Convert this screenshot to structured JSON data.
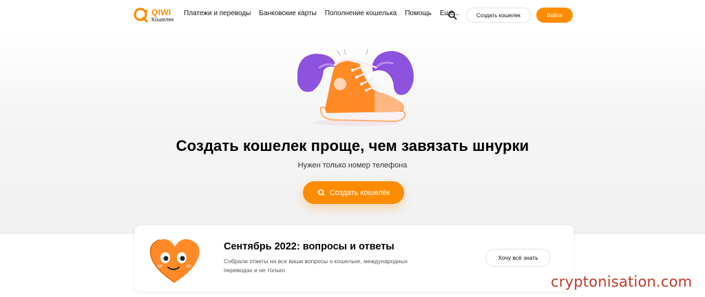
{
  "header": {
    "logo": {
      "brand": "QIWI",
      "sub": "Кошелек"
    },
    "nav": [
      {
        "label": "Платежи и переводы"
      },
      {
        "label": "Банковские карты"
      },
      {
        "label": "Пополнение кошелька"
      },
      {
        "label": "Помощь"
      },
      {
        "label": "Ещё..."
      }
    ],
    "search_icon": "search-icon",
    "create_wallet_label": "Создать кошелек",
    "login_label": "Войти"
  },
  "hero": {
    "illustration": "sneaker-with-hands",
    "title": "Создать кошелек проще, чем завязать шнурки",
    "subtitle": "Нужен только номер телефона",
    "cta_label": "Создать кошелёк",
    "cta_icon": "qiwi-logo-icon"
  },
  "faq_card": {
    "illustration": "heart-character",
    "title": "Сентябрь 2022: вопросы и ответы",
    "text": "Собрали ответы на все ваши вопросы о кошельке, международных переводах и не только",
    "button_label": "Хочу всё знать"
  },
  "watermark": "cryptonisation.com",
  "colors": {
    "accent": "#ff8c00",
    "purple": "#8a4fdc",
    "watermark": "#c0392b"
  }
}
